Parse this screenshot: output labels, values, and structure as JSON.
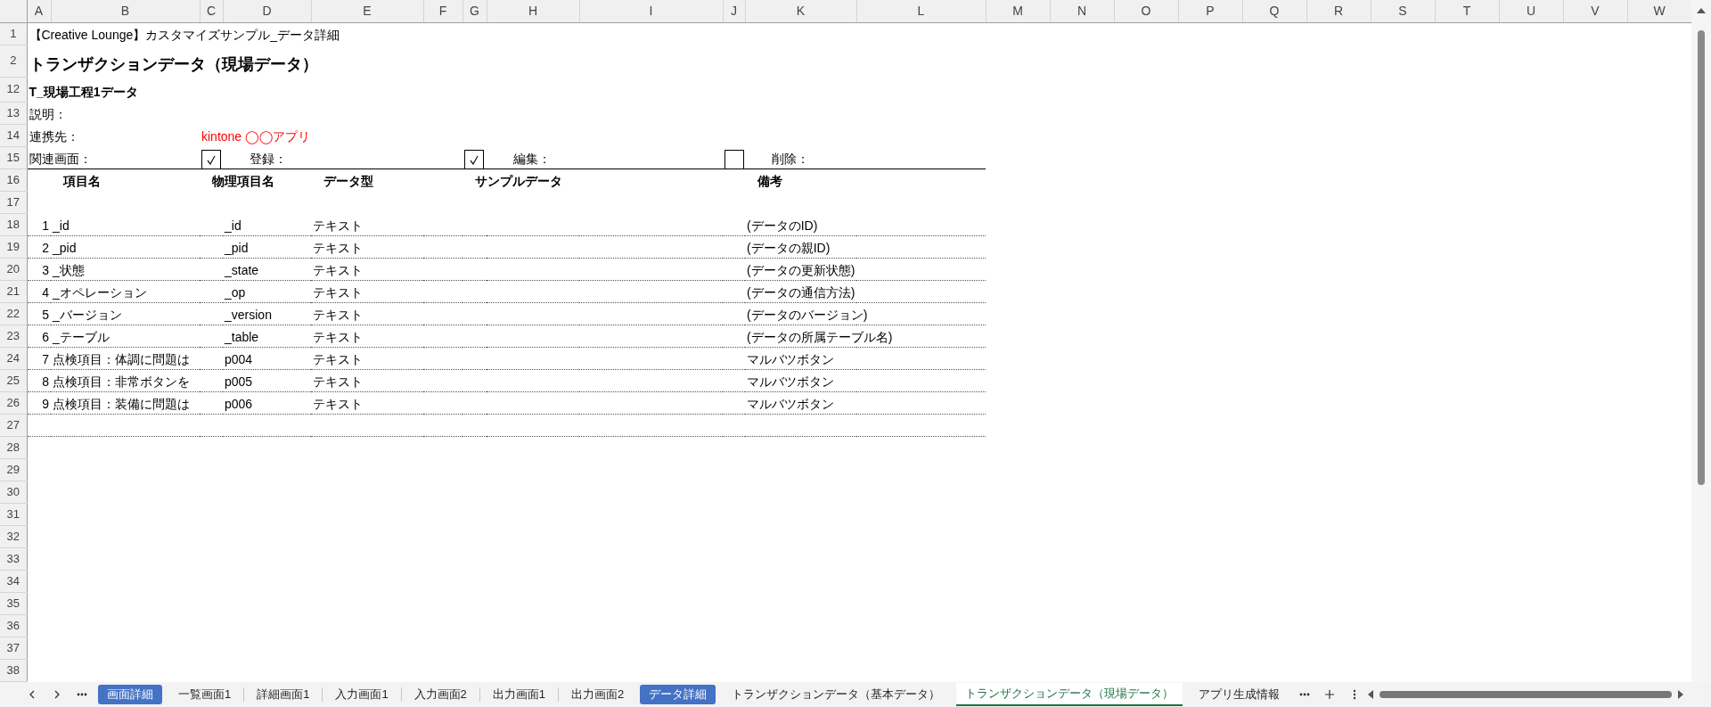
{
  "columns": [
    "A",
    "B",
    "C",
    "D",
    "E",
    "F",
    "G",
    "H",
    "I",
    "J",
    "K",
    "L",
    "M",
    "N",
    "O",
    "P",
    "Q",
    "R",
    "S",
    "T",
    "U",
    "V",
    "W"
  ],
  "row_numbers": [
    "1",
    "2",
    "12",
    "13",
    "14",
    "15",
    "16",
    "17",
    "18",
    "19",
    "20",
    "21",
    "22",
    "23",
    "24",
    "25",
    "26",
    "27",
    "28",
    "29",
    "30",
    "31",
    "32",
    "33",
    "34",
    "35",
    "36",
    "37",
    "38"
  ],
  "file_title": "【Creative Lounge】カスタマイズサンプル_データ詳細",
  "sheet_title": "トランザクションデータ（現場データ）",
  "table_name": "T_現場工程1データ",
  "description_label": "説明：",
  "link_label": "連携先：",
  "link_value": "kintone ◯◯アプリ",
  "related_label": "関連画面：",
  "screens": [
    {
      "label": "登録：",
      "checked": true
    },
    {
      "label": "編集：",
      "checked": true
    },
    {
      "label": "削除：",
      "checked": false
    }
  ],
  "fields": {
    "columns": [
      "項目名",
      "物理項目名",
      "データ型",
      "サンプルデータ",
      "備考"
    ],
    "rows": [
      {
        "no": "1",
        "name": "_id",
        "physical": "_id",
        "type": "テキスト",
        "note": "(データのID)"
      },
      {
        "no": "2",
        "name": "_pid",
        "physical": "_pid",
        "type": "テキスト",
        "note": "(データの親ID)"
      },
      {
        "no": "3",
        "name": "_状態",
        "physical": "_state",
        "type": "テキスト",
        "note": "(データの更新状態)"
      },
      {
        "no": "4",
        "name": "_オペレーション",
        "physical": "_op",
        "type": "テキスト",
        "note": "(データの通信方法)"
      },
      {
        "no": "5",
        "name": "_バージョン",
        "physical": "_version",
        "type": "テキスト",
        "note": "(データのバージョン)"
      },
      {
        "no": "6",
        "name": "_テーブル",
        "physical": "_table",
        "type": "テキスト",
        "note": "(データの所属テーブル名)"
      },
      {
        "no": "7",
        "name": "点検項目：体調に問題は",
        "physical": "p004",
        "type": "テキスト",
        "note": "マルバツボタン"
      },
      {
        "no": "8",
        "name": "点検項目：非常ボタンを",
        "physical": "p005",
        "type": "テキスト",
        "note": "マルバツボタン"
      },
      {
        "no": "9",
        "name": "点検項目：装備に問題は",
        "physical": "p006",
        "type": "テキスト",
        "note": "マルバツボタン"
      }
    ]
  },
  "sheet_tabs": [
    {
      "label": "画面詳細",
      "selected": false,
      "color": "#4472c4"
    },
    {
      "label": "一覧画面1",
      "selected": false
    },
    {
      "label": "詳細画面1",
      "selected": false
    },
    {
      "label": "入力画面1",
      "selected": false
    },
    {
      "label": "入力画面2",
      "selected": false
    },
    {
      "label": "出力画面1",
      "selected": false
    },
    {
      "label": "出力画面2",
      "selected": false
    },
    {
      "label": "データ詳細",
      "selected": false,
      "color": "#4472c4"
    },
    {
      "label": "トランザクションデータ（基本データ）",
      "selected": false
    },
    {
      "label": "トランザクションデータ（現場データ）",
      "selected": true
    },
    {
      "label": "アプリ生成情報",
      "selected": false
    }
  ]
}
